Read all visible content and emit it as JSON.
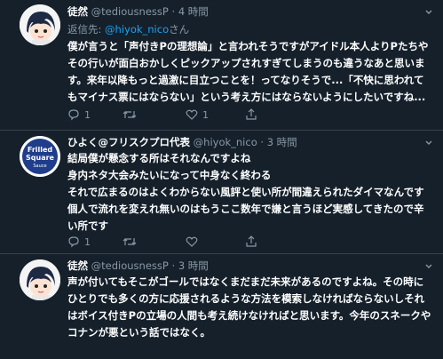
{
  "tweets": [
    {
      "name": "徒然",
      "handle": "@tediousnessP",
      "dot": "·",
      "time": "4 時間",
      "reply_prefix": "返信先: ",
      "reply_mention": "@hiyok_nico",
      "reply_suffix": "さん",
      "lines": [
        "僕が言うと「声付きPの理想論」と言われそうですがアイドル本人よりPたちや",
        "その行いが面白おかしくピックアップされすぎてしまうのも違うなあと思いま",
        "す。来年以降もっと過激に目立つことを！ってなりそうで...「不快に思われて",
        "もマイナス票にはならない」という考え方にはならないようにしたいですね..."
      ],
      "actions": {
        "reply_count": "1",
        "retweet_count": "",
        "like_count": "1"
      }
    },
    {
      "name": "ひよく@フリスクプロ代表",
      "handle": "@hiyok_nico",
      "dot": "·",
      "time": "3 時間",
      "lines": [
        "結局僕が懸念する所はそれなんですよね",
        "身内ネタ大会みたいになって中身なく終わる",
        "それで広まるのはよくわからない風評と使い所が間違えられたダイマなんです",
        "個人で流れを変えれ無いのはもうここ数年で嫌と言うほど実感してきたので辛",
        "い所です"
      ],
      "avatar_text": [
        "Frilled",
        "Square",
        "Sauce"
      ],
      "actions": {
        "reply_count": "1",
        "retweet_count": "",
        "like_count": ""
      }
    },
    {
      "name": "徒然",
      "handle": "@tediousnessP",
      "dot": "·",
      "time": "3 時間",
      "lines": [
        "声が付いてもそこがゴールではなくまだまだ未来があるのですよね。その時に",
        "ひとりでも多くの方に応援されるような方法を模索しなければならないしそれ",
        "はボイス付きPの立場の人間も考え続けなければと思います。今年のスネークや",
        "コナンが悪という話ではなく。"
      ]
    }
  ],
  "colors": {
    "background": "#15202b",
    "muted": "#8899a6",
    "accent": "#1da1f2",
    "divider": "#38444d"
  }
}
